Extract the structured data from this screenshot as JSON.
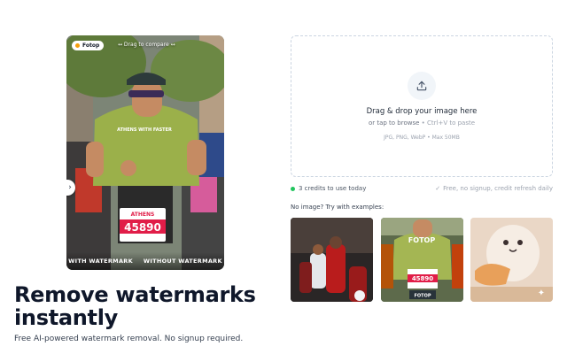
{
  "compare": {
    "brand": "Fotop",
    "drag_hint": "↔ Drag to compare ↔",
    "label_left": "WITH WATERMARK",
    "label_right": "WITHOUT WATERMARK",
    "bib_number": "45890",
    "shirt_text": "ATHENS WITH FASTER"
  },
  "hero": {
    "title": "Remove watermarks instantly",
    "subtitle": "Free AI-powered watermark removal. No signup required."
  },
  "dropzone": {
    "title": "Drag & drop your image here",
    "sub_prefix": "or tap to browse",
    "sub_shortcut": "• Ctrl+V to paste",
    "formats": "JPG, PNG, WebP • Max 50MB",
    "icon": "upload-icon"
  },
  "credits": {
    "left": "3 credits to use today",
    "right": "Free, no signup, credit refresh daily"
  },
  "examples": {
    "label": "No image? Try with examples:",
    "thumb2_text": "FOTOP",
    "thumb2_bib": "45890",
    "thumb2_caption": "FOTOP"
  },
  "colors": {
    "accent_green": "#22c55e",
    "brand_dot": "#f59e0b",
    "headline": "#0f172a"
  }
}
